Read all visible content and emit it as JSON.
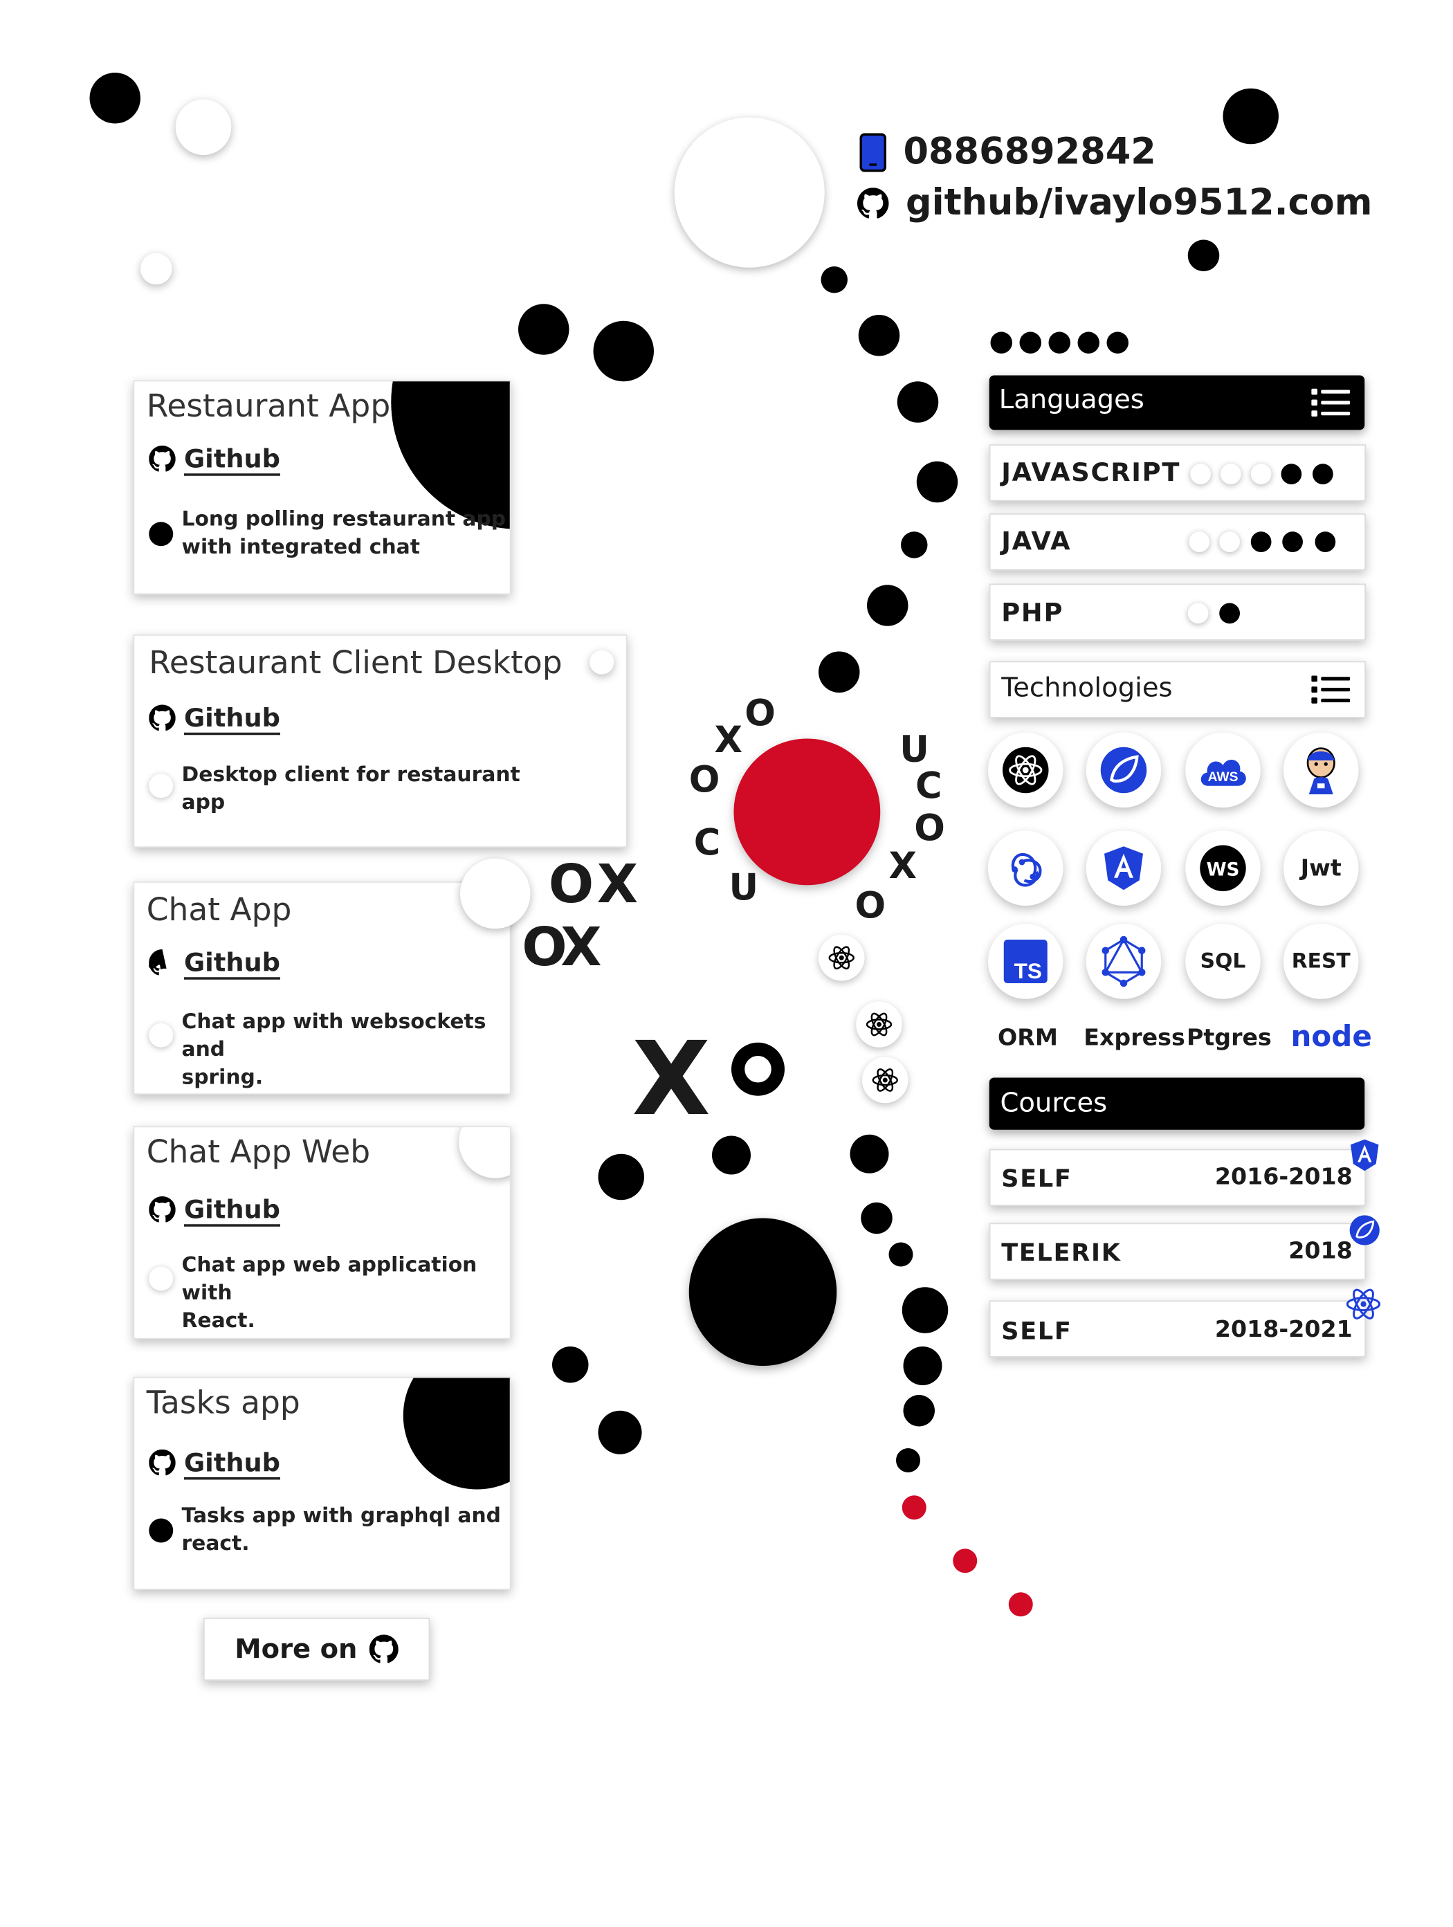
{
  "contact": {
    "phone": "0886892842",
    "github": "github/ivaylo9512.com",
    "phone_icon": "phone-icon",
    "github_icon": "github-icon"
  },
  "projects": [
    {
      "title": "Restaurant App",
      "link": "Github",
      "description_line1": "Long polling restaurant app",
      "description_line2": "with integrated chat"
    },
    {
      "title": "Restaurant Client Desktop",
      "link": "Github",
      "description_line1": "Desktop client for restaurant",
      "description_line2": "app"
    },
    {
      "title": "Chat App",
      "link": "Github",
      "description_line1": "Chat app with websockets and",
      "description_line2": "spring."
    },
    {
      "title": "Chat App Web",
      "link": "Github",
      "description_line1": "Chat app web application with",
      "description_line2": "React."
    },
    {
      "title": "Tasks app",
      "link": "Github",
      "description_line1": "Tasks app with graphql and",
      "description_line2": "react."
    }
  ],
  "more_button": {
    "label": "More on",
    "icon": "github-icon"
  },
  "languages": {
    "header": "Languages",
    "header_icon": "list-icon",
    "items": [
      {
        "name": "JAVASCRIPT",
        "level": 2,
        "max": 5
      },
      {
        "name": "JAVA",
        "level": 3,
        "max": 5
      },
      {
        "name": "PHP",
        "level": 1,
        "max": 2
      }
    ]
  },
  "technologies": {
    "header": "Technologies",
    "header_icon": "list-icon",
    "icons": [
      "react-icon",
      "spring-icon",
      "aws-icon",
      "jenkins-icon",
      "redux-icon",
      "angular-icon",
      "websocket-icon",
      "jwt-icon",
      "typescript-icon",
      "graphql-icon",
      "sql-icon",
      "rest-icon"
    ],
    "aws_label": "AWS",
    "ws_label": "WS",
    "jwt_label": "Jwt",
    "ts_label": "TS",
    "sql_label": "SQL",
    "rest_label": "REST",
    "text_items": [
      "ORM",
      "Express",
      "Ptgres",
      "node"
    ]
  },
  "courses": {
    "header": "Cources",
    "items": [
      {
        "name": "SELF",
        "years": "2016-2018",
        "icon": "angular-icon"
      },
      {
        "name": "TELERIK",
        "years": "2018",
        "icon": "spring-icon"
      },
      {
        "name": "SELF",
        "years": "2018-2021",
        "icon": "react-icon"
      }
    ]
  },
  "ring_letters": [
    "X",
    "O",
    "U",
    "C",
    "O",
    "X",
    "O",
    "U",
    "C",
    "O"
  ],
  "decor_text": {
    "ox1_o": "O",
    "ox1_x": "X",
    "ox2_o": "O",
    "ox2_x": "X",
    "big_x": "X"
  },
  "colors": {
    "accent_red": "#d10a26",
    "accent_blue": "#1e3fd8",
    "black": "#000000"
  }
}
